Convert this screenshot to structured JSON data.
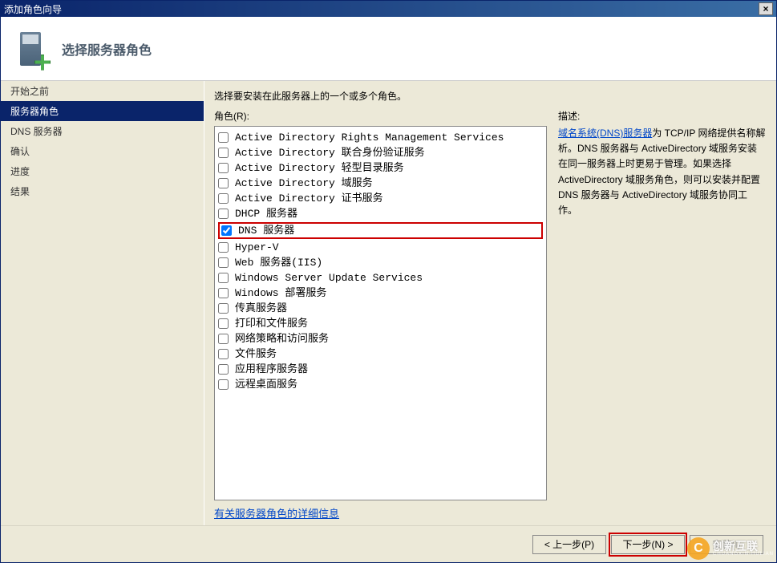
{
  "window": {
    "title": "添加角色向导",
    "close_x": "×"
  },
  "header": {
    "title": "选择服务器角色"
  },
  "sidebar": {
    "items": [
      {
        "label": "开始之前",
        "active": false
      },
      {
        "label": "服务器角色",
        "active": true
      },
      {
        "label": "DNS 服务器",
        "active": false
      },
      {
        "label": "确认",
        "active": false
      },
      {
        "label": "进度",
        "active": false
      },
      {
        "label": "结果",
        "active": false
      }
    ]
  },
  "main": {
    "instruction": "选择要安装在此服务器上的一个或多个角色。",
    "roles_label": "角色(R):",
    "roles": [
      {
        "name": "Active Directory Rights Management Services",
        "checked": false,
        "highlight": false
      },
      {
        "name": "Active Directory 联合身份验证服务",
        "checked": false,
        "highlight": false
      },
      {
        "name": "Active Directory 轻型目录服务",
        "checked": false,
        "highlight": false
      },
      {
        "name": "Active Directory 域服务",
        "checked": false,
        "highlight": false
      },
      {
        "name": "Active Directory 证书服务",
        "checked": false,
        "highlight": false
      },
      {
        "name": "DHCP 服务器",
        "checked": false,
        "highlight": false
      },
      {
        "name": "DNS 服务器",
        "checked": true,
        "highlight": true
      },
      {
        "name": "Hyper-V",
        "checked": false,
        "highlight": false
      },
      {
        "name": "Web 服务器(IIS)",
        "checked": false,
        "highlight": false
      },
      {
        "name": "Windows Server Update Services",
        "checked": false,
        "highlight": false
      },
      {
        "name": "Windows 部署服务",
        "checked": false,
        "highlight": false
      },
      {
        "name": "传真服务器",
        "checked": false,
        "highlight": false
      },
      {
        "name": "打印和文件服务",
        "checked": false,
        "highlight": false
      },
      {
        "name": "网络策略和访问服务",
        "checked": false,
        "highlight": false
      },
      {
        "name": "文件服务",
        "checked": false,
        "highlight": false
      },
      {
        "name": "应用程序服务器",
        "checked": false,
        "highlight": false
      },
      {
        "name": "远程桌面服务",
        "checked": false,
        "highlight": false
      }
    ],
    "details_link": "有关服务器角色的详细信息",
    "desc_label": "描述:",
    "desc_link_text": "域名系统(DNS)服务器",
    "desc_rest": "为 TCP/IP 网络提供名称解析。DNS 服务器与 ActiveDirectory 域服务安装在同一服务器上时更易于管理。如果选择 ActiveDirectory 域服务角色，则可以安装并配置 DNS 服务器与 ActiveDirectory 域服务协同工作。"
  },
  "footer": {
    "prev": "< 上一步(P)",
    "next": "下一步(N) >",
    "install": "安装(I)"
  },
  "brand": {
    "main": "创新互联",
    "sub": "CHUANGXIN-HULIAN"
  }
}
